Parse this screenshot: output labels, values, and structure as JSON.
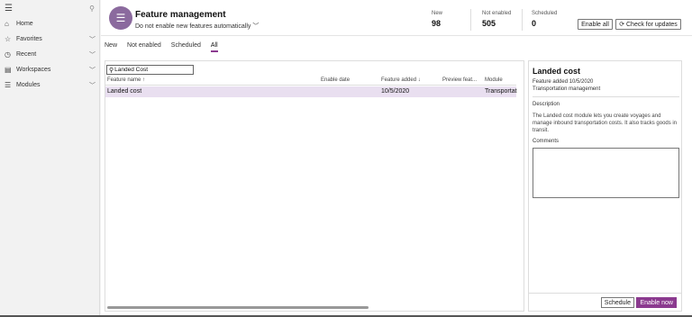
{
  "nav": {
    "items": [
      {
        "label": "Home",
        "icon": "⌂"
      },
      {
        "label": "Favorites",
        "icon": "☆"
      },
      {
        "label": "Recent",
        "icon": "◷"
      },
      {
        "label": "Workspaces",
        "icon": "▤"
      },
      {
        "label": "Modules",
        "icon": "☰"
      }
    ]
  },
  "header": {
    "title": "Feature management",
    "subtitle": "Do not enable new features automatically",
    "stats": [
      {
        "label": "New",
        "value": "98"
      },
      {
        "label": "Not enabled",
        "value": "505"
      },
      {
        "label": "Scheduled",
        "value": "0"
      }
    ],
    "enable_all_label": "Enable all",
    "check_updates_label": "Check for updates"
  },
  "tabs": [
    {
      "label": "New"
    },
    {
      "label": "Not enabled"
    },
    {
      "label": "Scheduled"
    },
    {
      "label": "All",
      "active": true
    }
  ],
  "grid": {
    "search_value": "Landed Cost",
    "columns": [
      "Feature name ↑",
      "Enable date",
      "Feature added ↓",
      "Preview feat...",
      "Module"
    ],
    "rows": [
      {
        "feature_name": "Landed cost",
        "enable_date": "",
        "feature_added": "10/5/2020",
        "preview": "",
        "module": "Transportat"
      }
    ]
  },
  "detail": {
    "title": "Landed cost",
    "feature_added": "Feature added 10/5/2020",
    "module": "Transportation management",
    "description_heading": "Description",
    "description": "The Landed cost module lets you create voyages and manage inbound transportation costs. It also tracks goods in transit.",
    "comments_heading": "Comments",
    "schedule_label": "Schedule",
    "enable_now_label": "Enable now"
  },
  "colors": {
    "accent": "#8b3a8f",
    "selected_row": "#e9dff0",
    "page_icon": "#8b6a9e"
  }
}
